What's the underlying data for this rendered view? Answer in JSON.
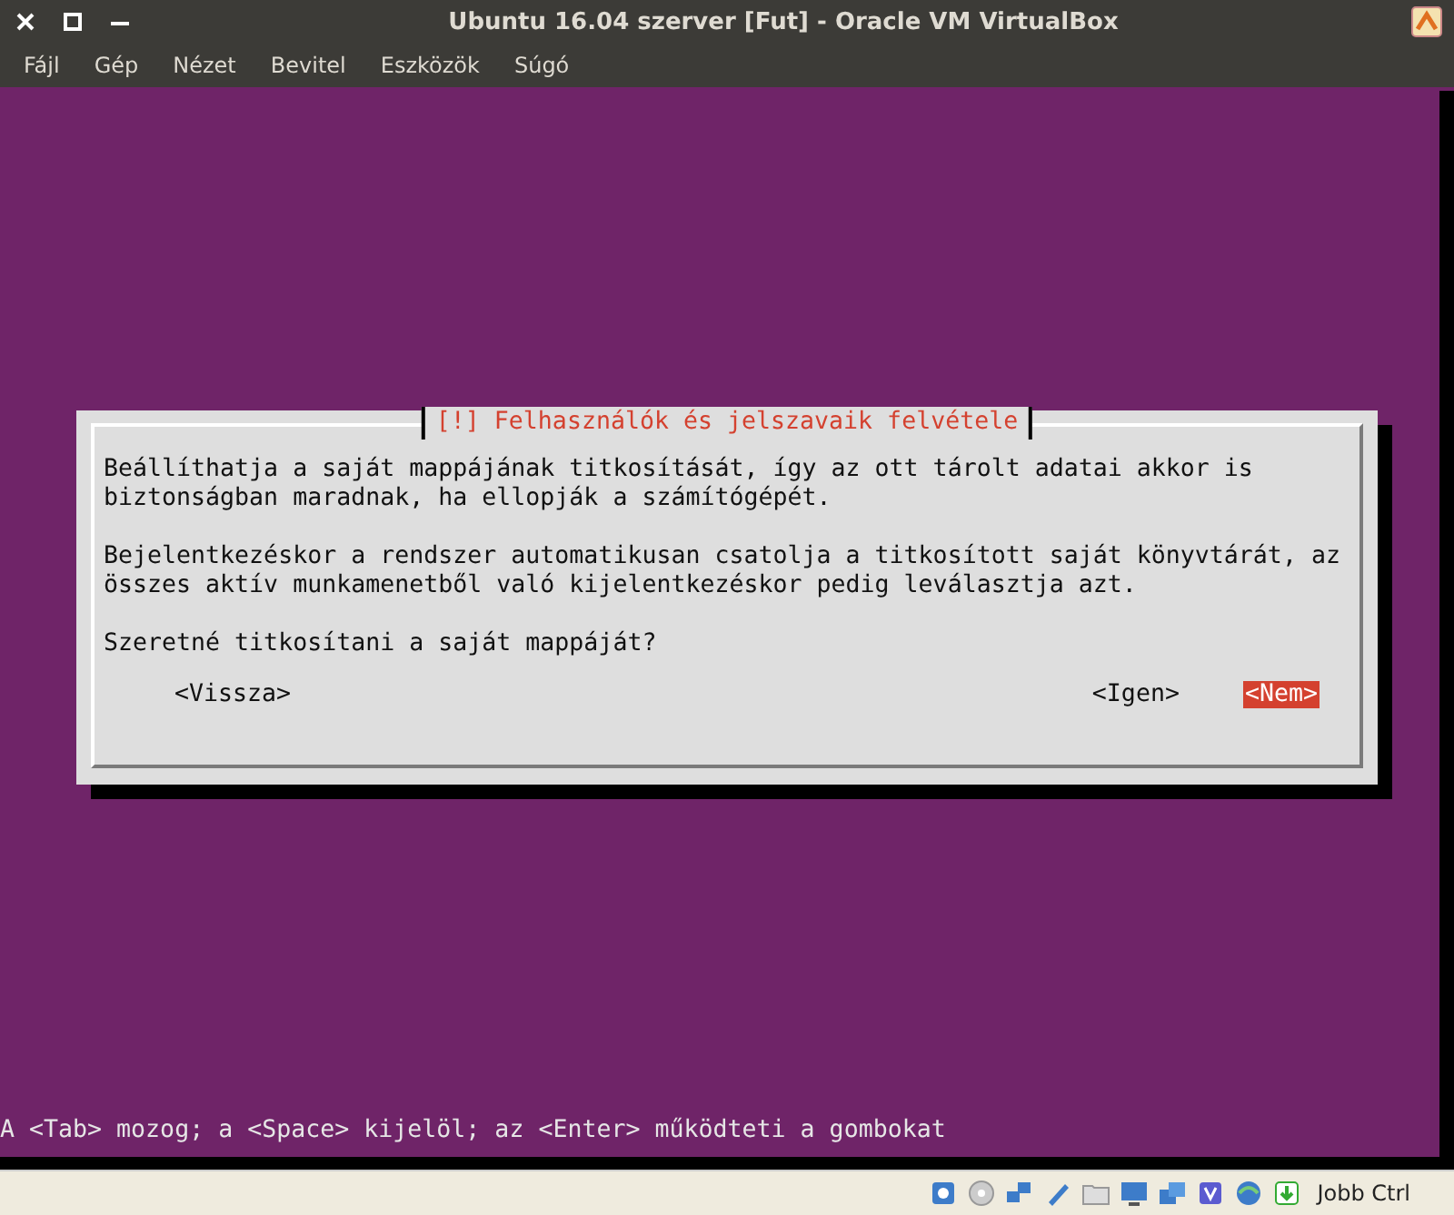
{
  "window": {
    "title": "Ubuntu 16.04 szerver [Fut] - Oracle VM VirtualBox"
  },
  "menu": [
    "Fájl",
    "Gép",
    "Nézet",
    "Bevitel",
    "Eszközök",
    "Súgó"
  ],
  "dialog": {
    "title": "[!] Felhasználók és jelszavaik felvétele",
    "paragraphs": [
      [
        "Beállíthatja a saját mappájának titkosítását, így az ott tárolt adatai akkor is",
        "biztonságban maradnak, ha ellopják a számítógépét."
      ],
      [
        "Bejelentkezéskor a rendszer automatikusan csatolja a titkosított saját könyvtárát, az",
        "összes aktív munkamenetből való kijelentkezéskor pedig leválasztja azt."
      ],
      [
        "Szeretné titkosítani a saját mappáját?"
      ]
    ],
    "buttons": [
      {
        "label": "<Vissza>",
        "selected": false
      },
      {
        "label": "<Igen>",
        "selected": false
      },
      {
        "label": "<Nem>",
        "selected": true
      }
    ]
  },
  "console_hint": "A <Tab> mozog; a <Space> kijelöl; az <Enter> működteti a gombokat",
  "status_bar": {
    "host_key": "Jobb Ctrl"
  }
}
